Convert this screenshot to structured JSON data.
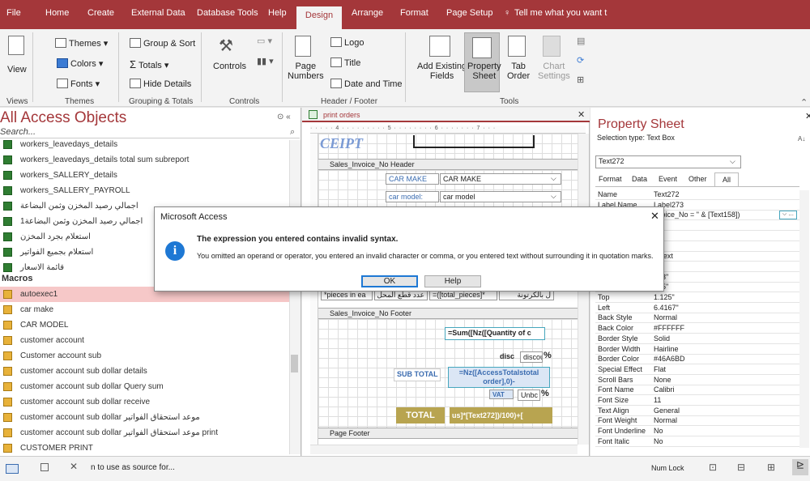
{
  "menu_tabs": [
    "File",
    "Home",
    "Create",
    "External Data",
    "Database Tools",
    "Help",
    "Design",
    "Arrange",
    "Format",
    "Page Setup"
  ],
  "active_tab": "Design",
  "tell_me": "Tell me what you want t",
  "ribbon": {
    "view": "View",
    "themes": "Themes",
    "colors": "Colors",
    "fonts": "Fonts",
    "group_sort": "Group & Sort",
    "totals": "Totals",
    "hide_details": "Hide Details",
    "controls": "Controls",
    "page_numbers": "Page\nNumbers",
    "logo": "Logo",
    "title": "Title",
    "date_time": "Date and Time",
    "add_existing": "Add Existing\nFields",
    "property_sheet": "Property\nSheet",
    "tab_order": "Tab\nOrder",
    "chart_settings": "Chart\nSettings",
    "groups": [
      "Views",
      "Themes",
      "Grouping & Totals",
      "Controls",
      "Header / Footer",
      "Tools"
    ]
  },
  "nav": {
    "title": "All Access Objects",
    "search_placeholder": "Search...",
    "items": [
      {
        "label": "workers_leavedays_details",
        "icon": "report-icon"
      },
      {
        "label": "workers_leavedays_details total sum subreport",
        "icon": "report-icon"
      },
      {
        "label": "workers_SALLERY_details",
        "icon": "report-icon"
      },
      {
        "label": "workers_SALLERY_PAYROLL",
        "icon": "report-icon"
      },
      {
        "label": "اجمالي رصيد المخزن وثمن البضاعة",
        "icon": "report-icon"
      },
      {
        "label": "اجمالي رصيد المخزن وثمن البضاعة1",
        "icon": "report-icon"
      },
      {
        "label": "استعلام بجرد المخزن",
        "icon": "report-icon"
      },
      {
        "label": "استعلام بجميع الفواتير",
        "icon": "report-icon"
      },
      {
        "label": "قائمة الاسعار",
        "icon": "report-icon"
      }
    ],
    "macros_header": "Macros",
    "macros": [
      "autoexec1",
      "car make",
      "CAR MODEL",
      "customer account",
      "Customer account sub",
      "customer account sub dollar details",
      "customer account sub dollar Query sum",
      "customer account sub dollar receive",
      "customer account sub dollar موعد استحقاق الفواتير",
      "customer account sub dollar موعد استحقاق الفواتير print",
      "CUSTOMER PRINT"
    ],
    "selected_macro": "autoexec1"
  },
  "design": {
    "tab_title": "print orders",
    "report_logo": "CEIPT",
    "sections": {
      "header": "Sales_Invoice_No Header",
      "footer": "Sales_Invoice_No Footer",
      "page_footer": "Page Footer"
    },
    "car_make_label": "CAR MAKE",
    "car_make_value": "CAR MAKE",
    "car_model_label": "car model:",
    "car_model_value": "car model",
    "pieces_label": "*pieces in ea",
    "pieces_formula": "=([total_pieces]*",
    "pieces_arabic": "عدد قطع المحل بالكرتونة",
    "pieces_right": "ل بالكرتونة",
    "sum_qty": "=Sum([Nz([Quantity of c",
    "disc_label": "disc",
    "disc_value": "discou",
    "pct": "%",
    "subtotal_label": "SUB TOTAL",
    "subtotal_expr": "=Nz([AccessTotalstotal order],0)-",
    "vat_label": "VAT",
    "vat_value": "Unbc",
    "total_label": "TOTAL",
    "total_expr": "us]*[Text272])/100)+["
  },
  "property_sheet": {
    "title": "Property Sheet",
    "selection_type": "Selection type:  Text Box",
    "selected_control": "Text272",
    "tabs": [
      "Format",
      "Data",
      "Event",
      "Other",
      "All"
    ],
    "active_tab": "All",
    "rows": [
      [
        "Name",
        "Text272"
      ],
      [
        "Label Name",
        "Label273"
      ],
      [
        "",
        "nvoice_No = \" & [Text158])"
      ],
      [
        "",
        ""
      ],
      [
        "",
        "o"
      ],
      [
        "",
        "s"
      ],
      [
        "",
        "n Text"
      ],
      [
        "",
        ""
      ],
      [
        "",
        "333\""
      ],
      [
        "",
        "875\""
      ],
      [
        "Top",
        "1.125\""
      ],
      [
        "Left",
        "6.4167\""
      ],
      [
        "Back Style",
        "Normal"
      ],
      [
        "Back Color",
        "#FFFFFF"
      ],
      [
        "Border Style",
        "Solid"
      ],
      [
        "Border Width",
        "Hairline"
      ],
      [
        "Border Color",
        "#46A6BD"
      ],
      [
        "Special Effect",
        "Flat"
      ],
      [
        "Scroll Bars",
        "None"
      ],
      [
        "Font Name",
        "Calibri"
      ],
      [
        "Font Size",
        "11"
      ],
      [
        "Text Align",
        "General"
      ],
      [
        "Font Weight",
        "Normal"
      ],
      [
        "Font Underline",
        "No"
      ],
      [
        "Font Italic",
        "No"
      ]
    ]
  },
  "dialog": {
    "title": "Microsoft Access",
    "heading": "The expression you entered contains invalid syntax.",
    "message": "You omitted an operand or operator, you entered an invalid character or comma, or you entered text without surrounding it in quotation marks.",
    "ok": "OK",
    "help": "Help"
  },
  "status": {
    "left_text": "n to use as source for...",
    "num_lock": "Num Lock"
  },
  "colors": {
    "accent": "#a4373a",
    "border_color": "#46A6BD",
    "total_bg": "#b8a450"
  }
}
